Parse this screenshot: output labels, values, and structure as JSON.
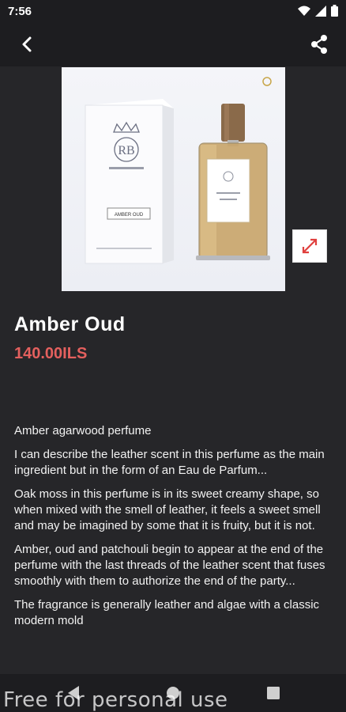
{
  "status_bar": {
    "time": "7:56"
  },
  "product": {
    "name": "Amber Oud",
    "price": "140.00ILS",
    "box_brand": "RB",
    "box_label": "AMBER OUD"
  },
  "description": [
    "Amber agarwood perfume",
    "I can describe the leather scent in this perfume as the main ingredient but in the form of an Eau de Parfum...",
    "Oak moss in this perfume is in its sweet creamy shape, so when mixed with the smell of leather, it feels a sweet smell and may be imagined by some that it is fruity, but it is not.",
    "Amber, oud and patchouli begin to appear at the end of the perfume with the last threads of the leather scent that fuses smoothly with them to authorize the end of the party...",
    "The fragrance is generally leather and algae with a classic modern mold"
  ],
  "watermark": "Free for personal use",
  "colors": {
    "price": "#e4605e",
    "background": "#262629",
    "bars": "#1d1d20"
  }
}
